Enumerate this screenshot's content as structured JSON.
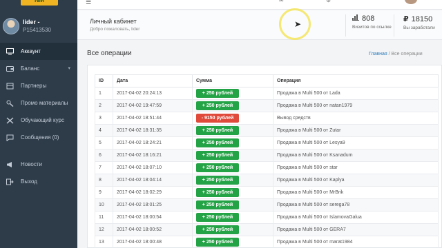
{
  "sidebar": {
    "logo_text": "NM",
    "user": {
      "name": "lider -",
      "id": "P15413530"
    },
    "items": [
      {
        "label": "Аккаунт",
        "icon": "monitor-icon",
        "active": true
      },
      {
        "label": "Баланс",
        "icon": "wallet-icon",
        "has_submenu": true
      },
      {
        "label": "Партнеры",
        "icon": "people-icon"
      },
      {
        "label": "Промо материалы",
        "icon": "wrench-icon"
      },
      {
        "label": "Обучающий курс",
        "icon": "tools-icon"
      },
      {
        "label": "Сообщения (0)",
        "icon": "chat-icon"
      }
    ],
    "items2": [
      {
        "label": "Новости",
        "icon": "megaphone-icon"
      },
      {
        "label": "Выход",
        "icon": "exit-icon"
      }
    ]
  },
  "header": {
    "title": "Личный кабинет",
    "subtitle": "Добро пожаловать, lider",
    "stats": [
      {
        "icon": "bar-chart-icon",
        "value": "808",
        "label": "Визитов по ссылке"
      },
      {
        "icon": "ruble-icon",
        "value": "18150",
        "label": "Вы заработали"
      }
    ]
  },
  "page": {
    "section_title": "Все операции",
    "breadcrumb": {
      "home": "Главная",
      "separator": "/",
      "current": "Все операции"
    }
  },
  "table": {
    "headers": [
      "ID",
      "Дата",
      "Сумма",
      "Операция"
    ],
    "rows": [
      {
        "id": "1",
        "date": "2017-04-02 20:24:13",
        "sum": "+ 250 рублей",
        "type": "plus",
        "op": "Продажа в Multi 500 от Lada"
      },
      {
        "id": "2",
        "date": "2017-04-02 19:47:59",
        "sum": "+ 250 рублей",
        "type": "plus",
        "op": "Продажа в Multi 500 от natan1979"
      },
      {
        "id": "3",
        "date": "2017-04-02 18:51:44",
        "sum": "- 9150 рублей",
        "type": "minus",
        "op": "Вывод средств"
      },
      {
        "id": "4",
        "date": "2017-04-02 18:31:35",
        "sum": "+ 250 рублей",
        "type": "plus",
        "op": "Продажа в Multi 500 от Zutar"
      },
      {
        "id": "5",
        "date": "2017-04-02 18:24:21",
        "sum": "+ 250 рублей",
        "type": "plus",
        "op": "Продажа в Multi 500 от Lesya9"
      },
      {
        "id": "6",
        "date": "2017-04-02 18:16:21",
        "sum": "+ 250 рублей",
        "type": "plus",
        "op": "Продажа в Multi 500 от Ksanadum"
      },
      {
        "id": "7",
        "date": "2017-04-02 18:07:10",
        "sum": "+ 250 рублей",
        "type": "plus",
        "op": "Продажа в Multi 500 от star"
      },
      {
        "id": "8",
        "date": "2017-04-02 18:04:14",
        "sum": "+ 250 рублей",
        "type": "plus",
        "op": "Продажа в Multi 500 от Kaplya"
      },
      {
        "id": "9",
        "date": "2017-04-02 18:02:29",
        "sum": "+ 250 рублей",
        "type": "plus",
        "op": "Продажа в Multi 500 от MrBrik"
      },
      {
        "id": "10",
        "date": "2017-04-02 18:01:25",
        "sum": "+ 250 рублей",
        "type": "plus",
        "op": "Продажа в Multi 500 от serega78"
      },
      {
        "id": "11",
        "date": "2017-04-02 18:00:54",
        "sum": "+ 250 рублей",
        "type": "plus",
        "op": "Продажа в Multi 500 от IslamovaGalua"
      },
      {
        "id": "12",
        "date": "2017-04-02 18:00:52",
        "sum": "+ 250 рублей",
        "type": "plus",
        "op": "Продажа в Multi 500 от GERA7"
      },
      {
        "id": "13",
        "date": "2017-04-02 18:00:48",
        "sum": "+ 250 рублей",
        "type": "plus",
        "op": "Продажа в Multi 500 от marat1984"
      }
    ]
  },
  "colors": {
    "sidebar": "#2e3c4a",
    "plus": "#24a346",
    "minus": "#e04a3a",
    "link": "#2a7ab8"
  }
}
